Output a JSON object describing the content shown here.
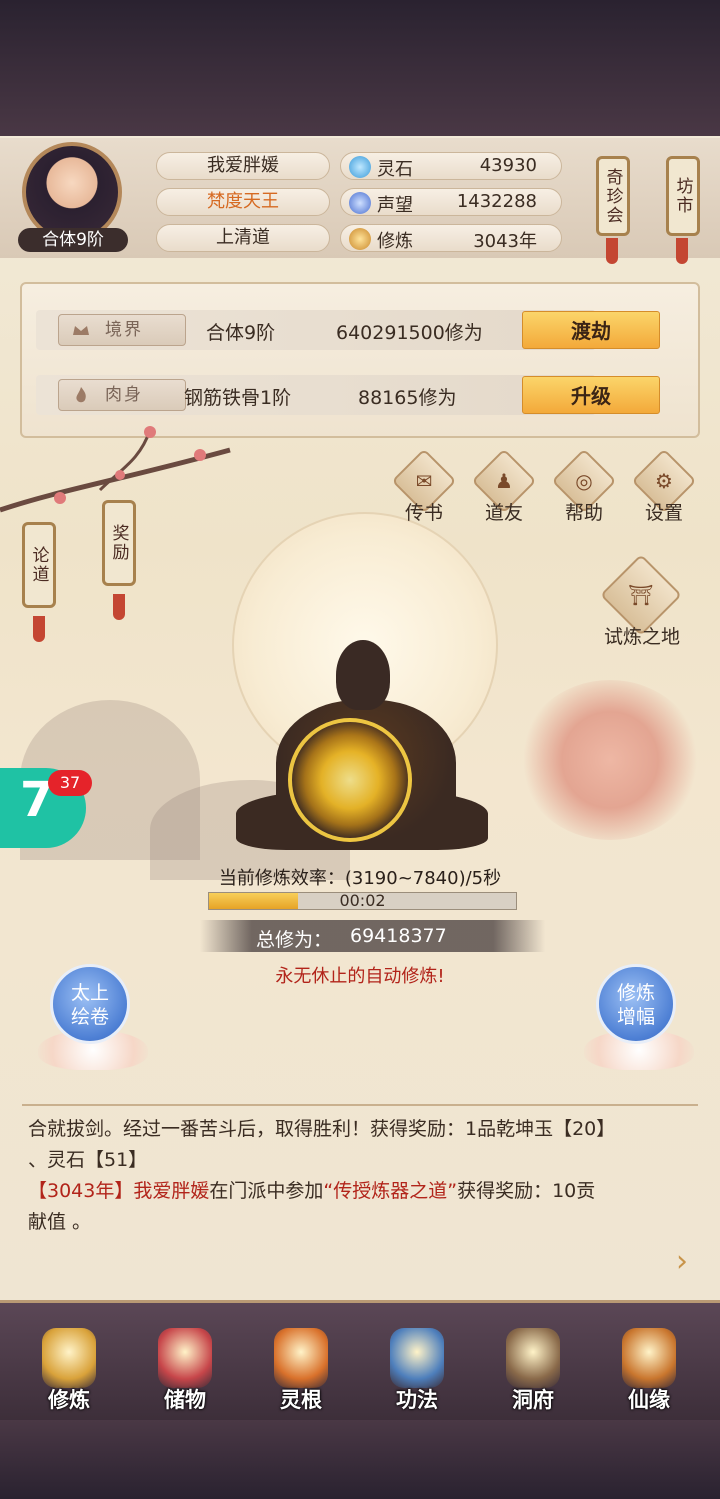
{
  "player": {
    "name": "我爱胖媛",
    "title": "梵度天王",
    "sect": "上清道",
    "rank": "合体9阶"
  },
  "stats": [
    {
      "icon": "spirit-stone-icon",
      "label": "灵石",
      "value": "43930"
    },
    {
      "icon": "prestige-icon",
      "label": "声望",
      "value": "1432288"
    },
    {
      "icon": "cultivation-icon",
      "label": "修炼",
      "value": "3043年"
    }
  ],
  "top_buttons": {
    "treasure_fair": "奇珍会",
    "market": "坊市"
  },
  "realm": {
    "tag": "境界",
    "level": "合体9阶",
    "exp": "640291500修为",
    "button": "渡劫"
  },
  "body": {
    "tag": "肉身",
    "level": "钢筋铁骨1阶",
    "exp": "88165修为",
    "button": "升级"
  },
  "side_scrolls": {
    "discuss": "论道",
    "reward": "奖励"
  },
  "menu": [
    {
      "label": "传书",
      "icon": "mail-icon"
    },
    {
      "label": "道友",
      "icon": "friend-icon"
    },
    {
      "label": "帮助",
      "icon": "help-icon"
    },
    {
      "label": "设置",
      "icon": "gear-icon"
    }
  ],
  "trial": {
    "label": "试炼之地"
  },
  "cultivation": {
    "rate": "当前修炼效率：(3190~7840)/5秒",
    "timer": "00:02",
    "progress": 0.29,
    "total_label": "总修为：",
    "total_value": "69418377",
    "auto": "永无休止的自动修炼!"
  },
  "float_badge": {
    "number": "7",
    "count": "37"
  },
  "orbs": {
    "left": [
      "太上",
      "绘卷"
    ],
    "right": [
      "修炼",
      "增幅"
    ]
  },
  "log": {
    "line1": "合就拔剑。经过一番苦斗后，取得胜利！获得奖励：1品乾坤玉【20】",
    "line2": "、灵石【51】",
    "line3_year": "【3043年】",
    "line3_name": "我爱胖媛",
    "line3_mid": "在门派中参加",
    "line3_event": "“传授炼器之道”",
    "line3_end": "获得奖励：10贡",
    "line4": "献值 。"
  },
  "nav": [
    {
      "label": "修炼",
      "icon": "cultivate-icon",
      "color": "#d9a23a"
    },
    {
      "label": "储物",
      "icon": "storage-icon",
      "color": "#c7464a"
    },
    {
      "label": "灵根",
      "icon": "spirit-root-icon",
      "color": "#d9712b"
    },
    {
      "label": "功法",
      "icon": "technique-icon",
      "color": "#4e7fbc"
    },
    {
      "label": "洞府",
      "icon": "cave-icon",
      "color": "#8a6a4a"
    },
    {
      "label": "仙缘",
      "icon": "destiny-icon",
      "color": "#c9762e"
    }
  ]
}
